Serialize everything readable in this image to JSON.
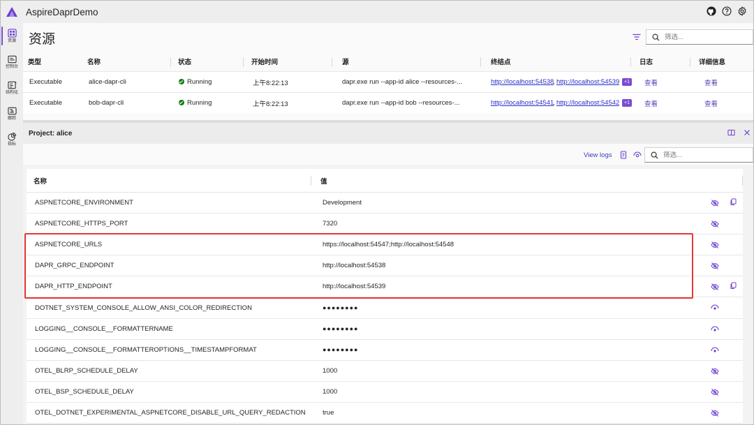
{
  "app": {
    "title": "AspireDaprDemo",
    "colors": {
      "accent": "#7a4cd1",
      "running": "#107c10",
      "highlight": "#e53935",
      "link": "#2c2cc9"
    }
  },
  "header_icons": [
    "github-icon",
    "help-icon",
    "settings-icon"
  ],
  "sidebar": {
    "items": [
      {
        "label": "资源",
        "icon": "grid-icon",
        "active": true
      },
      {
        "label": "控制台",
        "icon": "console-icon",
        "active": false
      },
      {
        "label": "结构化",
        "icon": "structured-logs-icon",
        "active": false
      },
      {
        "label": "跟踪",
        "icon": "traces-icon",
        "active": false
      },
      {
        "label": "指标",
        "icon": "metrics-icon",
        "active": false
      }
    ]
  },
  "resources": {
    "title": "资源",
    "search_placeholder": "筛选...",
    "columns": [
      "类型",
      "名称",
      "状态",
      "开始时间",
      "源",
      "终结点",
      "日志",
      "详细信息"
    ],
    "rows": [
      {
        "type": "Executable",
        "name": "alice-dapr-cli",
        "state": "Running",
        "start": "上午8:22:13",
        "source": "dapr.exe run --app-id alice --resources-...",
        "endpoint1": "http://localhost:54538",
        "endpoint2": "http://localhost:54539",
        "more": "+1",
        "logs": "查看",
        "details": "查看"
      },
      {
        "type": "Executable",
        "name": "bob-dapr-cli",
        "state": "Running",
        "start": "上午8:22:13",
        "source": "dapr.exe run --app-id bob --resources-...",
        "endpoint1": "http://localhost:54541",
        "endpoint2": "http://localhost:54542",
        "more": "+1",
        "logs": "查看",
        "details": "查看"
      }
    ]
  },
  "details": {
    "title": "Project: alice",
    "view_logs": "View logs",
    "search_placeholder": "筛选...",
    "columns": [
      "名称",
      "值"
    ],
    "env": [
      {
        "name": "ASPNETCORE_ENVIRONMENT",
        "value": "Development",
        "masked": false,
        "copy": true
      },
      {
        "name": "ASPNETCORE_HTTPS_PORT",
        "value": "7320",
        "masked": false,
        "copy": false
      },
      {
        "name": "ASPNETCORE_URLS",
        "value": "https://localhost:54547;http://localhost:54548",
        "masked": false,
        "copy": false
      },
      {
        "name": "DAPR_GRPC_ENDPOINT",
        "value": "http://localhost:54538",
        "masked": false,
        "copy": false
      },
      {
        "name": "DAPR_HTTP_ENDPOINT",
        "value": "http://localhost:54539",
        "masked": false,
        "copy": true
      },
      {
        "name": "DOTNET_SYSTEM_CONSOLE_ALLOW_ANSI_COLOR_REDIRECTION",
        "value": "●●●●●●●●",
        "masked": true,
        "copy": false
      },
      {
        "name": "LOGGING__CONSOLE__FORMATTERNAME",
        "value": "●●●●●●●●",
        "masked": true,
        "copy": false
      },
      {
        "name": "LOGGING__CONSOLE__FORMATTEROPTIONS__TIMESTAMPFORMAT",
        "value": "●●●●●●●●",
        "masked": true,
        "copy": false
      },
      {
        "name": "OTEL_BLRP_SCHEDULE_DELAY",
        "value": "1000",
        "masked": false,
        "copy": false
      },
      {
        "name": "OTEL_BSP_SCHEDULE_DELAY",
        "value": "1000",
        "masked": false,
        "copy": false
      },
      {
        "name": "OTEL_DOTNET_EXPERIMENTAL_ASPNETCORE_DISABLE_URL_QUERY_REDACTION",
        "value": "true",
        "masked": false,
        "copy": false
      }
    ]
  }
}
